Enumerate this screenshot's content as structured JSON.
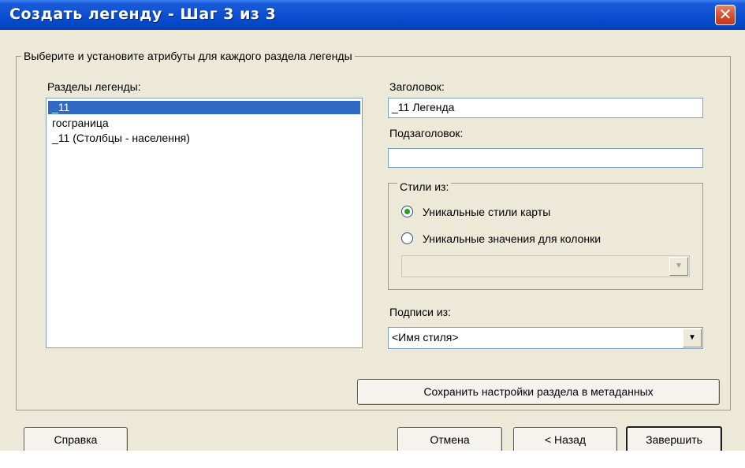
{
  "window": {
    "title": "Создать легенду - Шаг 3 из 3",
    "close_glyph": "✕"
  },
  "group": {
    "label": "Выберите и установите атрибуты для каждого раздела легенды"
  },
  "sections": {
    "label": "Разделы легенды:",
    "items": [
      {
        "label": "_11",
        "selected": true
      },
      {
        "label": "госграница",
        "selected": false
      },
      {
        "label": "_11 (Столбцы - населення)",
        "selected": false
      }
    ]
  },
  "title_field": {
    "label": "Заголовок:",
    "value": "_11 Легенда"
  },
  "subtitle_field": {
    "label": "Подзаголовок:",
    "value": ""
  },
  "styles": {
    "label": "Стили из:",
    "options": [
      {
        "label": "Уникальные стили карты",
        "checked": true
      },
      {
        "label": "Уникальные значения для колонки",
        "checked": false
      }
    ],
    "column_select": {
      "value": "",
      "disabled": true
    }
  },
  "labels_from": {
    "label": "Подписи из:",
    "value": "<Имя стиля>"
  },
  "buttons": {
    "save_meta": "Сохранить настройки раздела в метаданных",
    "help": "Справка",
    "cancel": "Отмена",
    "back": "< Назад",
    "finish": "Завершить"
  },
  "colors": {
    "titlebar": "#0a4ed0",
    "selection": "#316ac5",
    "dialog_bg": "#ece9d8",
    "close_button": "#d2482a",
    "radio_dot": "#21a121"
  },
  "icons": {
    "dropdown": "triangle-down-icon",
    "close": "close-icon",
    "radio": "radio-dot-icon"
  }
}
